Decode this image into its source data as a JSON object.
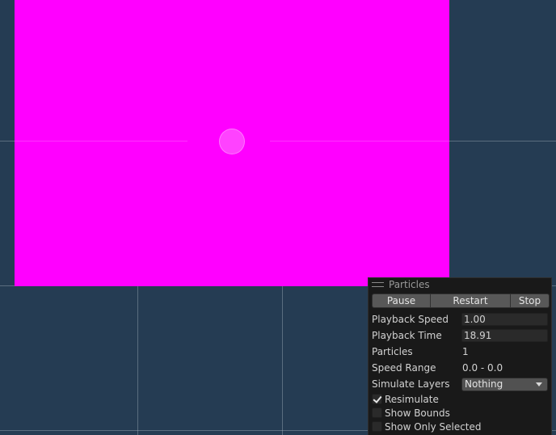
{
  "colors": {
    "scene_background": "#253c53",
    "particle_color": "#ff00ff",
    "panel_background": "#191919",
    "button_background": "#585858"
  },
  "panel": {
    "title": "Particles",
    "buttons": {
      "pause": "Pause",
      "restart": "Restart",
      "stop": "Stop"
    },
    "rows": {
      "playback_speed": {
        "label": "Playback Speed",
        "value": "1.00"
      },
      "playback_time": {
        "label": "Playback Time",
        "value": "18.91"
      },
      "particles": {
        "label": "Particles",
        "value": "1"
      },
      "speed_range": {
        "label": "Speed Range",
        "value": "0.0 - 0.0"
      },
      "simulate_layers": {
        "label": "Simulate Layers",
        "value": "Nothing"
      }
    },
    "checkboxes": {
      "resimulate": {
        "label": "Resimulate",
        "checked": true
      },
      "show_bounds": {
        "label": "Show Bounds",
        "checked": false
      },
      "show_only_selected": {
        "label": "Show Only Selected",
        "checked": false
      }
    }
  }
}
